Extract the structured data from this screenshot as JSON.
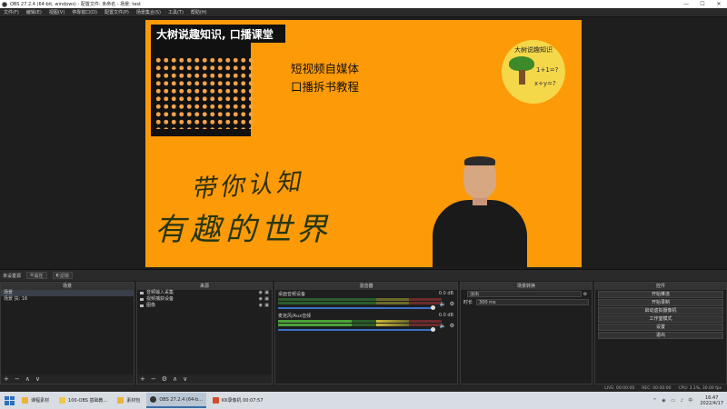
{
  "window": {
    "title": "OBS 27.2.4 (64-bit, windows) - 配置文件: 未命名 - 场景: test",
    "controls": [
      "—",
      "☐",
      "✕"
    ]
  },
  "menu": [
    "文件(F)",
    "编辑(E)",
    "视图(V)",
    "停靠窗口(D)",
    "配置文件(P)",
    "场景集合(S)",
    "工具(T)",
    "帮助(H)"
  ],
  "preview": {
    "banner": "大树说趣知识, 口播课堂",
    "subtitle1": "短视频自媒体",
    "subtitle2": "口播拆书教程",
    "logo_title": "大树说趣知识",
    "logo_eq1": "1+1=?",
    "logo_eq2": "x+y=?",
    "handwriting1": "带你认知",
    "handwriting2": "有趣的世界"
  },
  "controls_bar": {
    "scene_label": "未设置源",
    "prop_button": "属性",
    "filter_button": "滤镜"
  },
  "docks": {
    "scenes": {
      "title": "场景",
      "items": [
        "场景",
        "场景 扶: 16"
      ],
      "toolbar": [
        "+",
        "−",
        "∧",
        "∨"
      ]
    },
    "sources": {
      "title": "来源",
      "items": [
        "音频输入采集",
        "视频捕获设备",
        "图像"
      ],
      "toolbar": [
        "+",
        "−",
        "⚙",
        "∧",
        "∨"
      ]
    },
    "mixer": {
      "title": "混音器",
      "channels": [
        {
          "name": "桌面音频设备",
          "db": "0.0 dB"
        },
        {
          "name": "麦克风/Aux音频",
          "db": "0.0 dB"
        }
      ]
    },
    "transitions": {
      "title": "场景转换",
      "type": "淡出",
      "duration_label": "时长",
      "duration_value": "300 ms"
    },
    "controls": {
      "title": "控件",
      "buttons": [
        "开始推流",
        "开始录制",
        "启动虚拟摄像机",
        "工作室模式",
        "设置",
        "退出"
      ]
    }
  },
  "statusbar": {
    "live": "LIVE: 00:00:00",
    "rec": "REC: 00:00:00",
    "cpu": "CPU: 3.1%, 30.00 fps"
  },
  "taskbar": {
    "items": [
      {
        "label": "课程素材",
        "color": "#e9b43a",
        "active": false
      },
      {
        "label": "100-OBS 基础教...",
        "color": "#f1c84a",
        "active": false
      },
      {
        "label": "素材包",
        "color": "#e9b43a",
        "active": false
      },
      {
        "label": "OBS 27.2.4 (64-b...",
        "color": "#333333",
        "active": true
      },
      {
        "label": "KK录像机 00:07:57",
        "color": "#d64b2a",
        "active": false
      }
    ],
    "tray_icons": "^ ◉ ▭ ♪ 中",
    "time": "16:47",
    "date": "2022/4/17"
  }
}
